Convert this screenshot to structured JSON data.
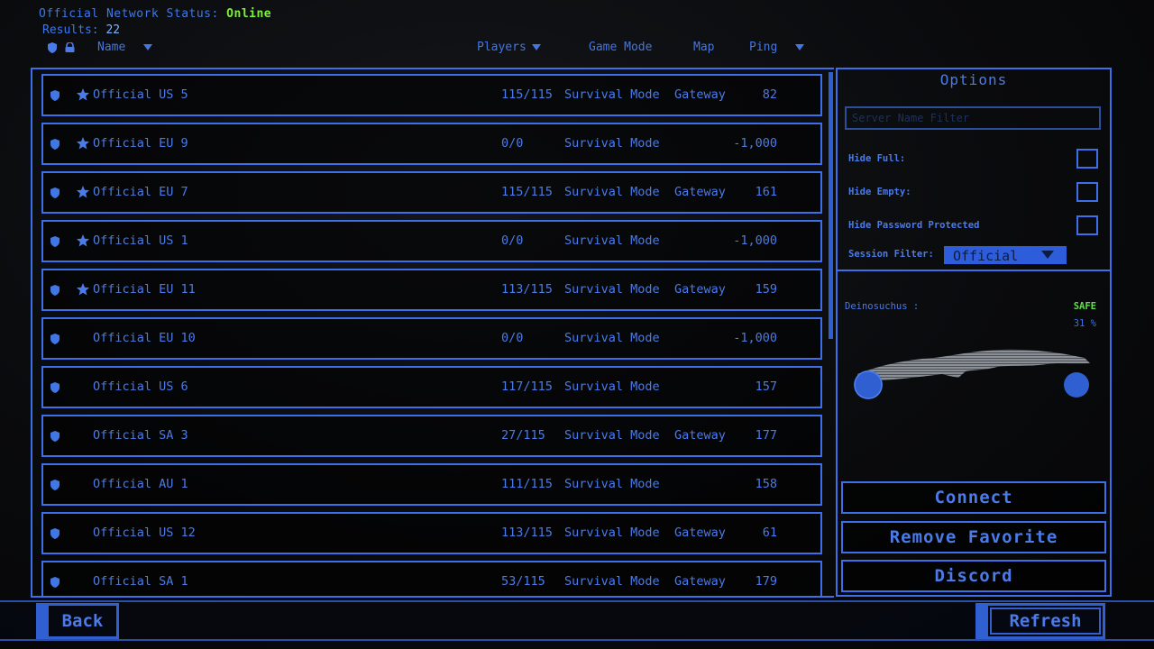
{
  "status": {
    "label": "Official Network Status:",
    "value": "Online"
  },
  "results": {
    "label": "Results:",
    "count": "22"
  },
  "columns": {
    "name": "Name",
    "players": "Players",
    "game_mode": "Game Mode",
    "map": "Map",
    "ping": "Ping"
  },
  "servers": [
    {
      "name": "Official US 5",
      "favorite": true,
      "players": "115/115",
      "mode": "Survival Mode",
      "map": "Gateway",
      "ping": "82"
    },
    {
      "name": "Official EU 9",
      "favorite": true,
      "players": "0/0",
      "mode": "Survival Mode",
      "map": "",
      "ping": "-1,000"
    },
    {
      "name": "Official EU 7",
      "favorite": true,
      "players": "115/115",
      "mode": "Survival Mode",
      "map": "Gateway",
      "ping": "161"
    },
    {
      "name": "Official US 1",
      "favorite": true,
      "players": "0/0",
      "mode": "Survival Mode",
      "map": "",
      "ping": "-1,000"
    },
    {
      "name": "Official EU 11",
      "favorite": true,
      "players": "113/115",
      "mode": "Survival Mode",
      "map": "Gateway",
      "ping": "159"
    },
    {
      "name": "Official EU 10",
      "favorite": false,
      "players": "0/0",
      "mode": "Survival Mode",
      "map": "",
      "ping": "-1,000"
    },
    {
      "name": "Official US 6",
      "favorite": false,
      "players": "117/115",
      "mode": "Survival Mode",
      "map": "",
      "ping": "157"
    },
    {
      "name": "Official SA 3",
      "favorite": false,
      "players": "27/115",
      "mode": "Survival Mode",
      "map": "Gateway",
      "ping": "177"
    },
    {
      "name": "Official AU 1",
      "favorite": false,
      "players": "111/115",
      "mode": "Survival Mode",
      "map": "",
      "ping": "158"
    },
    {
      "name": "Official US 12",
      "favorite": false,
      "players": "113/115",
      "mode": "Survival Mode",
      "map": "Gateway",
      "ping": "61"
    },
    {
      "name": "Official SA 1",
      "favorite": false,
      "players": "53/115",
      "mode": "Survival Mode",
      "map": "Gateway",
      "ping": "179"
    }
  ],
  "options": {
    "title": "Options",
    "filter_placeholder": "Server Name Filter",
    "hide_full": "Hide Full:",
    "hide_empty": "Hide Empty:",
    "hide_password": "Hide Password Protected",
    "session_filter_label": "Session Filter:",
    "session_filter_value": "Official",
    "dino_name": "Deinosuchus :",
    "dino_status": "SAFE",
    "dino_percent": "31 %",
    "dino_level": 0.31
  },
  "buttons": {
    "connect": "Connect",
    "remove_favorite": "Remove Favorite",
    "discord": "Discord",
    "back": "Back",
    "refresh": "Refresh"
  },
  "colors": {
    "accent": "#3c6fe8",
    "online": "#7cf03a",
    "safe": "#5ee04a",
    "background": "#0a0b0d"
  }
}
